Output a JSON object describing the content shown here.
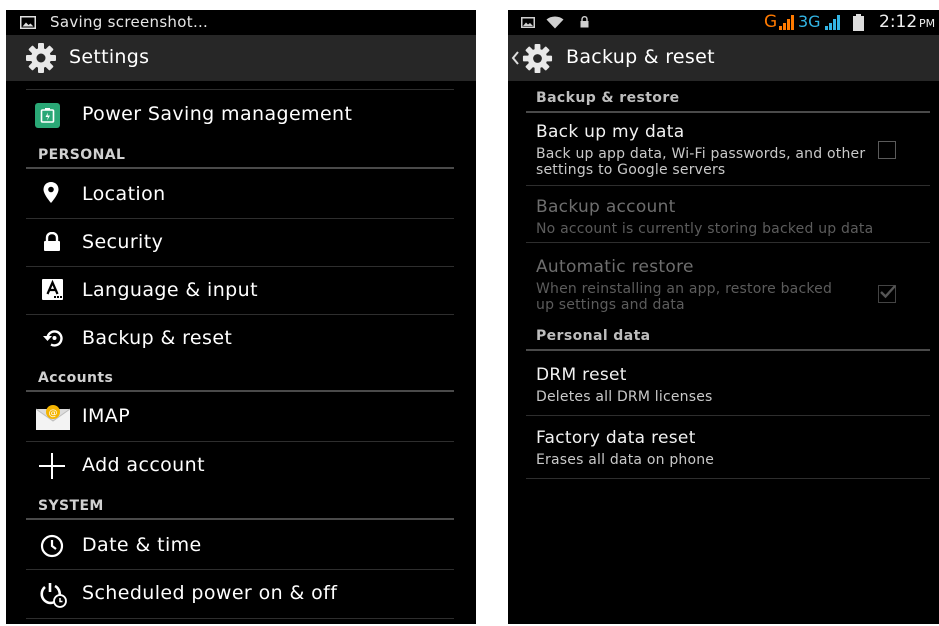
{
  "left": {
    "status": {
      "text": "Saving screenshot…",
      "icon": "image-icon"
    },
    "actionbar": {
      "title": "Settings",
      "icon": "gear-icon"
    },
    "top_item": {
      "label": "Power Saving management",
      "icon": "battery-saver-icon",
      "icon_color": "#2aa876"
    },
    "sections": [
      {
        "header": "PERSONAL",
        "items": [
          {
            "label": "Location",
            "icon": "location-pin-icon"
          },
          {
            "label": "Security",
            "icon": "lock-icon"
          },
          {
            "label": "Language & input",
            "icon": "keyboard-a-icon"
          },
          {
            "label": "Backup & reset",
            "icon": "backup-restore-icon"
          }
        ]
      },
      {
        "header": "Accounts",
        "items": [
          {
            "label": "IMAP",
            "icon": "mail-envelope-icon"
          },
          {
            "label": "Add account",
            "icon": "plus-icon"
          }
        ]
      },
      {
        "header": "SYSTEM",
        "items": [
          {
            "label": "Date & time",
            "icon": "clock-icon"
          },
          {
            "label": "Scheduled power on & off",
            "icon": "scheduled-power-icon"
          }
        ]
      }
    ]
  },
  "right": {
    "status": {
      "network_g": "G",
      "network_3g": "3G",
      "time": "2:12",
      "ampm": "PM",
      "colors": {
        "orange": "#ff7a00",
        "blue": "#33b5e5"
      }
    },
    "actionbar": {
      "title": "Backup & reset",
      "icon": "gear-icon",
      "back_icon": "back-chevron-icon"
    },
    "sections": [
      {
        "header": "Backup & restore",
        "items": [
          {
            "title": "Back up my data",
            "subtitle": "Back up app data, Wi-Fi passwords, and other settings to Google servers",
            "checkbox": false,
            "enabled": true
          },
          {
            "title": "Backup account",
            "subtitle": "No account is currently storing backed up data",
            "enabled": false
          },
          {
            "title": "Automatic restore",
            "subtitle": "When reinstalling an app, restore backed up settings and data",
            "checkbox": true,
            "enabled": false
          }
        ]
      },
      {
        "header": "Personal data",
        "items": [
          {
            "title": "DRM reset",
            "subtitle": "Deletes all DRM licenses",
            "enabled": true
          },
          {
            "title": "Factory data reset",
            "subtitle": "Erases all data on phone",
            "enabled": true
          }
        ]
      }
    ]
  }
}
